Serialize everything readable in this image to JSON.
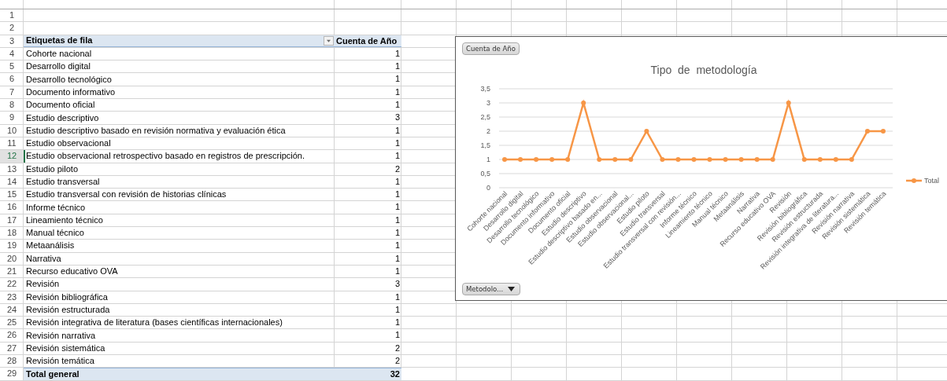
{
  "sheet": {
    "blank_rows": [
      "1",
      "2"
    ],
    "pivot": {
      "header_row": "3",
      "columns": [
        "Etiquetas de fila",
        "Cuenta de Año"
      ],
      "rows": [
        {
          "row": "4",
          "label": "Cohorte nacional",
          "count": "1",
          "selected": false
        },
        {
          "row": "5",
          "label": "Desarrollo digital",
          "count": "1",
          "selected": false
        },
        {
          "row": "6",
          "label": "Desarrollo tecnológico",
          "count": "1",
          "selected": false
        },
        {
          "row": "7",
          "label": "Documento informativo",
          "count": "1",
          "selected": false
        },
        {
          "row": "8",
          "label": "Documento oficial",
          "count": "1",
          "selected": false
        },
        {
          "row": "9",
          "label": "Estudio descriptivo",
          "count": "3",
          "selected": false
        },
        {
          "row": "10",
          "label": "Estudio descriptivo basado en revisión normativa y evaluación ética",
          "count": "1",
          "selected": false
        },
        {
          "row": "11",
          "label": "Estudio observacional",
          "count": "1",
          "selected": false
        },
        {
          "row": "12",
          "label": "Estudio observacional retrospectivo basado en registros de prescripción.",
          "count": "1",
          "selected": true
        },
        {
          "row": "13",
          "label": "Estudio piloto",
          "count": "2",
          "selected": false
        },
        {
          "row": "14",
          "label": "Estudio transversal",
          "count": "1",
          "selected": false
        },
        {
          "row": "15",
          "label": "Estudio transversal con revisión de historias clínicas",
          "count": "1",
          "selected": false
        },
        {
          "row": "16",
          "label": "Informe técnico",
          "count": "1",
          "selected": false
        },
        {
          "row": "17",
          "label": "Lineamiento técnico",
          "count": "1",
          "selected": false
        },
        {
          "row": "18",
          "label": "Manual técnico",
          "count": "1",
          "selected": false
        },
        {
          "row": "19",
          "label": "Metaanálisis",
          "count": "1",
          "selected": false
        },
        {
          "row": "20",
          "label": "Narrativa",
          "count": "1",
          "selected": false
        },
        {
          "row": "21",
          "label": "Recurso educativo OVA",
          "count": "1",
          "selected": false
        },
        {
          "row": "22",
          "label": "Revisión",
          "count": "3",
          "selected": false
        },
        {
          "row": "23",
          "label": "Revisión bibliográfica",
          "count": "1",
          "selected": false
        },
        {
          "row": "24",
          "label": "Revisión estructurada",
          "count": "1",
          "selected": false
        },
        {
          "row": "25",
          "label": "Revisión integrativa de literatura (bases científicas internacionales)",
          "count": "1",
          "selected": false
        },
        {
          "row": "26",
          "label": "Revisión narrativa",
          "count": "1",
          "selected": false
        },
        {
          "row": "27",
          "label": "Revisión sistemática",
          "count": "2",
          "selected": false
        },
        {
          "row": "28",
          "label": "Revisión temática",
          "count": "2",
          "selected": false
        }
      ],
      "total": {
        "row": "29",
        "label": "Total general",
        "count": "32"
      }
    }
  },
  "chart": {
    "field_button": "Cuenta de Año",
    "axis_button": "Metodolo...",
    "chart_data": {
      "type": "line",
      "title": "Tipo  de  metodología",
      "categories": [
        "Cohorte nacional",
        "Desarrollo digital",
        "Desarrollo tecnológico",
        "Documento informativo",
        "Documento oficial",
        "Estudio descriptivo",
        "Estudio descriptivo basado en...",
        "Estudio observacional",
        "Estudio observacional...",
        "Estudio piloto",
        "Estudio transversal",
        "Estudio transversal con revisión...",
        "Informe técnico",
        "Lineamiento técnico",
        "Manual técnico",
        "Metaanálisis",
        "Narrativa",
        "Recurso educativo OVA",
        "Revisión",
        "Revisión bibliográfica",
        "Revisión estructurada",
        "Revisión integrativa de literatura...",
        "Revisión narrativa",
        "Revisión sistemática",
        "Revisión temática"
      ],
      "grid": true,
      "series": [
        {
          "name": "Total",
          "color": "#f79646",
          "marker": "circle",
          "values": [
            1,
            1,
            1,
            1,
            1,
            3,
            1,
            1,
            1,
            2,
            1,
            1,
            1,
            1,
            1,
            1,
            1,
            1,
            3,
            1,
            1,
            1,
            1,
            2,
            2
          ]
        }
      ],
      "ylim": [
        0,
        3.5
      ],
      "yticks": [
        0,
        {
          "value": 0.5,
          "label": "0,5"
        },
        1,
        {
          "value": 1.5,
          "label": "1,5"
        },
        2,
        {
          "value": 2.5,
          "label": "2,5"
        },
        3,
        {
          "value": 3.5,
          "label": "3,5"
        }
      ]
    }
  }
}
